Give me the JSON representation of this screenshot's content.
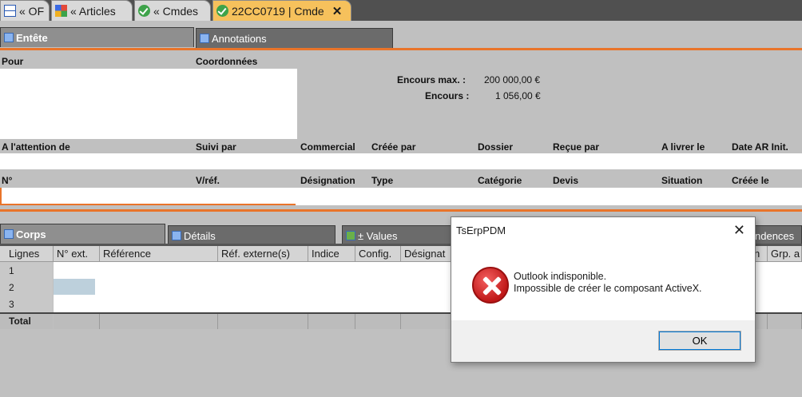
{
  "doc_tabs": [
    {
      "label": "« OF",
      "icon": "tree-icon"
    },
    {
      "label": "« Articles",
      "icon": "grid-icon"
    },
    {
      "label": "« Cmdes",
      "icon": "check-icon"
    },
    {
      "label": "22CC0719 | Cmde",
      "icon": "check-icon",
      "close": "✕"
    }
  ],
  "header_tabs": {
    "entete": "Entête",
    "annotations": "Annotations"
  },
  "header": {
    "pour": "Pour",
    "coordonnees": "Coordonnées",
    "encours_max_label": "Encours max. :",
    "encours_max_value": "200 000,00 €",
    "encours_label": "Encours :",
    "encours_value": "1 056,00 €",
    "row1": [
      "A l'attention de",
      "Suivi par",
      "Commercial",
      "Créée par",
      "Dossier",
      "Reçue par",
      "A livrer le",
      "Date AR Init."
    ],
    "row2": [
      "N°",
      "V/réf.",
      "Désignation",
      "Type",
      "Catégorie",
      "Devis",
      "Situation",
      "Créée le"
    ]
  },
  "body_tabs": {
    "corps": "Corps",
    "details": "Détails",
    "values": "± Values",
    "partial": "ndences"
  },
  "grid": {
    "columns": [
      "Lignes",
      "N° ext.",
      "Référence",
      "Réf. externe(s)",
      "Indice",
      "Config.",
      "Désignat",
      "n",
      "Grp. a"
    ],
    "rows": [
      "1",
      "2",
      "3"
    ],
    "total": "Total"
  },
  "dialog": {
    "title": "TsErpPDM",
    "close": "✕",
    "line1": "Outlook indisponible.",
    "line2": "Impossible de créer le composant ActiveX.",
    "ok": "OK"
  },
  "colors": {
    "accent": "#e9742a",
    "active_tab": "#f6c15c",
    "error": "#c01818"
  }
}
